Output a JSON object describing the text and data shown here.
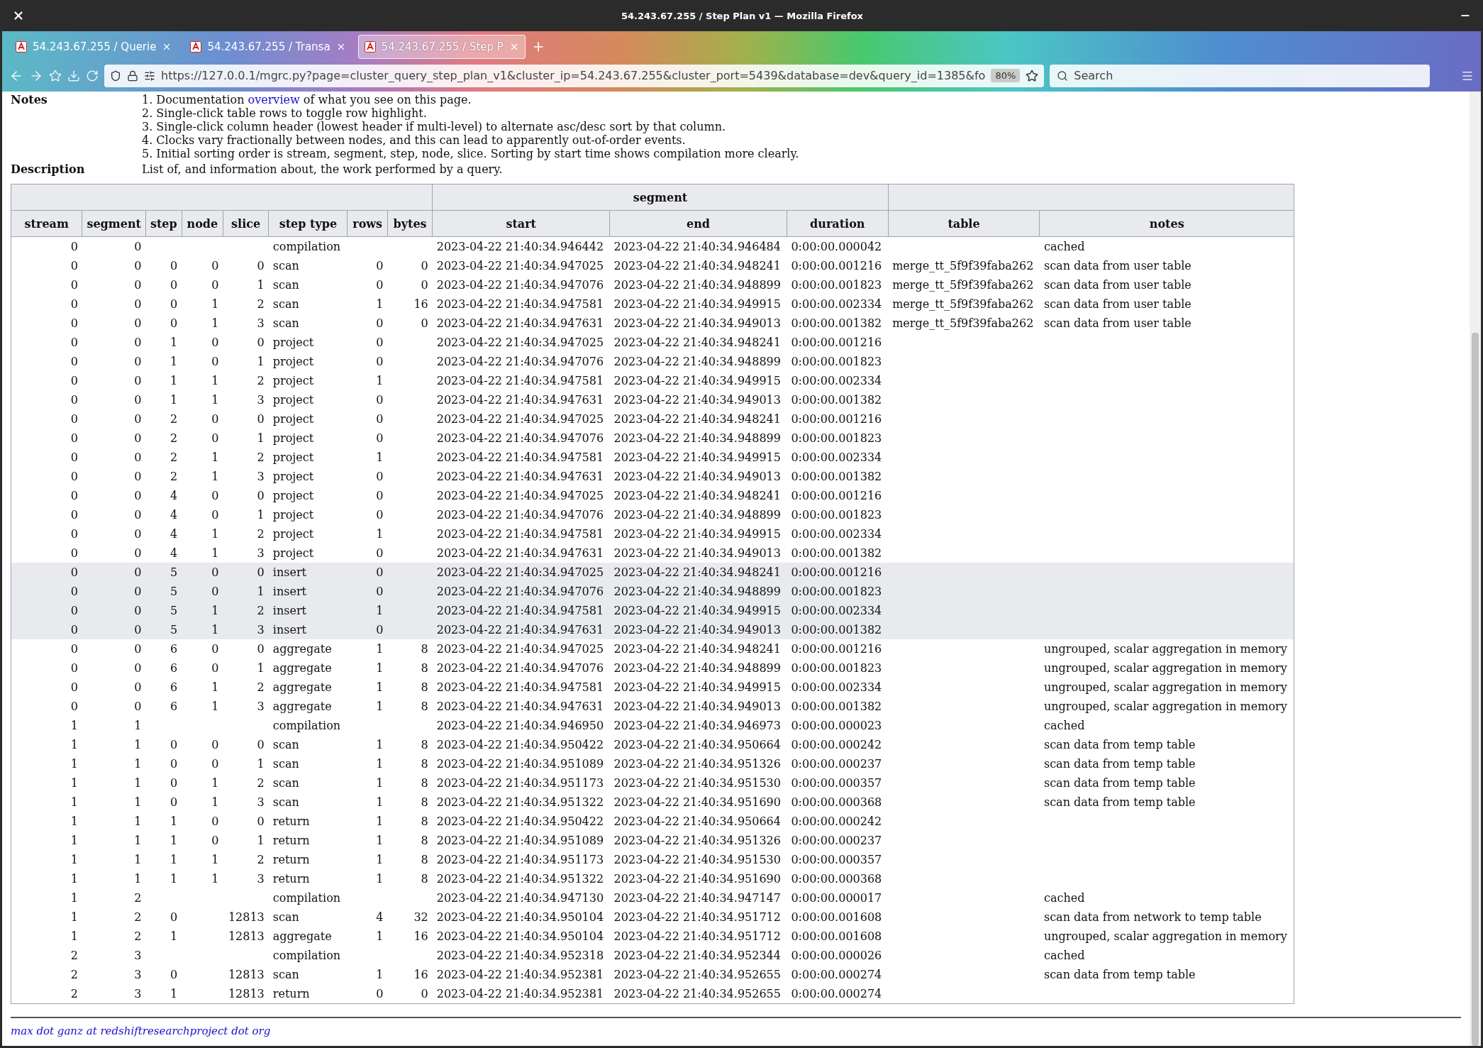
{
  "window": {
    "title": "54.243.67.255 / Step Plan v1 — Mozilla Firefox"
  },
  "tabs": [
    {
      "label": "54.243.67.255 / Querie",
      "selected": false
    },
    {
      "label": "54.243.67.255 / Transa",
      "selected": false
    },
    {
      "label": "54.243.67.255 / Step P",
      "selected": true
    }
  ],
  "address_bar": {
    "url": "https://127.0.0.1/mgrc.py?page=cluster_query_step_plan_v1&cluster_ip=54.243.67.255&cluster_port=5439&database=dev&query_id=1385&fo",
    "zoom": "80%"
  },
  "search": {
    "placeholder": "Search"
  },
  "notes": {
    "label": "Notes",
    "first": {
      "before": "1. Documentation ",
      "link": "overview",
      "after": " of what you see on this page."
    },
    "items": [
      "2. Single-click table rows to toggle row highlight.",
      "3. Single-click column header (lowest header if multi-level) to alternate asc/desc sort by that column.",
      "4. Clocks vary fractionally between nodes, and this can lead to apparently out-of-order events.",
      "5. Initial sorting order is stream, segment, step, node, slice. Sorting by start time shows compilation more clearly."
    ]
  },
  "description": {
    "label": "Description",
    "text": "List of, and information about, the work performed by a query."
  },
  "table": {
    "group_header": "segment",
    "columns": [
      "stream",
      "segment",
      "step",
      "node",
      "slice",
      "step type",
      "rows",
      "bytes",
      "start",
      "end",
      "duration",
      "table",
      "notes"
    ],
    "rows": [
      {
        "highlighted": false,
        "cells": [
          "0",
          "0",
          null,
          null,
          null,
          "compilation",
          null,
          null,
          "2023-04-22 21:40:34.946442",
          "2023-04-22 21:40:34.946484",
          "0:00:00.000042",
          null,
          "cached"
        ]
      },
      {
        "highlighted": false,
        "cells": [
          "0",
          "0",
          "0",
          "0",
          "0",
          "scan",
          "0",
          "0",
          "2023-04-22 21:40:34.947025",
          "2023-04-22 21:40:34.948241",
          "0:00:00.001216",
          "merge_tt_5f9f39faba262",
          "scan data from user table"
        ]
      },
      {
        "highlighted": false,
        "cells": [
          "0",
          "0",
          "0",
          "0",
          "1",
          "scan",
          "0",
          "0",
          "2023-04-22 21:40:34.947076",
          "2023-04-22 21:40:34.948899",
          "0:00:00.001823",
          "merge_tt_5f9f39faba262",
          "scan data from user table"
        ]
      },
      {
        "highlighted": false,
        "cells": [
          "0",
          "0",
          "0",
          "1",
          "2",
          "scan",
          "1",
          "16",
          "2023-04-22 21:40:34.947581",
          "2023-04-22 21:40:34.949915",
          "0:00:00.002334",
          "merge_tt_5f9f39faba262",
          "scan data from user table"
        ]
      },
      {
        "highlighted": false,
        "cells": [
          "0",
          "0",
          "0",
          "1",
          "3",
          "scan",
          "0",
          "0",
          "2023-04-22 21:40:34.947631",
          "2023-04-22 21:40:34.949013",
          "0:00:00.001382",
          "merge_tt_5f9f39faba262",
          "scan data from user table"
        ]
      },
      {
        "highlighted": false,
        "cells": [
          "0",
          "0",
          "1",
          "0",
          "0",
          "project",
          "0",
          null,
          "2023-04-22 21:40:34.947025",
          "2023-04-22 21:40:34.948241",
          "0:00:00.001216",
          null,
          null
        ]
      },
      {
        "highlighted": false,
        "cells": [
          "0",
          "0",
          "1",
          "0",
          "1",
          "project",
          "0",
          null,
          "2023-04-22 21:40:34.947076",
          "2023-04-22 21:40:34.948899",
          "0:00:00.001823",
          null,
          null
        ]
      },
      {
        "highlighted": false,
        "cells": [
          "0",
          "0",
          "1",
          "1",
          "2",
          "project",
          "1",
          null,
          "2023-04-22 21:40:34.947581",
          "2023-04-22 21:40:34.949915",
          "0:00:00.002334",
          null,
          null
        ]
      },
      {
        "highlighted": false,
        "cells": [
          "0",
          "0",
          "1",
          "1",
          "3",
          "project",
          "0",
          null,
          "2023-04-22 21:40:34.947631",
          "2023-04-22 21:40:34.949013",
          "0:00:00.001382",
          null,
          null
        ]
      },
      {
        "highlighted": false,
        "cells": [
          "0",
          "0",
          "2",
          "0",
          "0",
          "project",
          "0",
          null,
          "2023-04-22 21:40:34.947025",
          "2023-04-22 21:40:34.948241",
          "0:00:00.001216",
          null,
          null
        ]
      },
      {
        "highlighted": false,
        "cells": [
          "0",
          "0",
          "2",
          "0",
          "1",
          "project",
          "0",
          null,
          "2023-04-22 21:40:34.947076",
          "2023-04-22 21:40:34.948899",
          "0:00:00.001823",
          null,
          null
        ]
      },
      {
        "highlighted": false,
        "cells": [
          "0",
          "0",
          "2",
          "1",
          "2",
          "project",
          "1",
          null,
          "2023-04-22 21:40:34.947581",
          "2023-04-22 21:40:34.949915",
          "0:00:00.002334",
          null,
          null
        ]
      },
      {
        "highlighted": false,
        "cells": [
          "0",
          "0",
          "2",
          "1",
          "3",
          "project",
          "0",
          null,
          "2023-04-22 21:40:34.947631",
          "2023-04-22 21:40:34.949013",
          "0:00:00.001382",
          null,
          null
        ]
      },
      {
        "highlighted": false,
        "cells": [
          "0",
          "0",
          "4",
          "0",
          "0",
          "project",
          "0",
          null,
          "2023-04-22 21:40:34.947025",
          "2023-04-22 21:40:34.948241",
          "0:00:00.001216",
          null,
          null
        ]
      },
      {
        "highlighted": false,
        "cells": [
          "0",
          "0",
          "4",
          "0",
          "1",
          "project",
          "0",
          null,
          "2023-04-22 21:40:34.947076",
          "2023-04-22 21:40:34.948899",
          "0:00:00.001823",
          null,
          null
        ]
      },
      {
        "highlighted": false,
        "cells": [
          "0",
          "0",
          "4",
          "1",
          "2",
          "project",
          "1",
          null,
          "2023-04-22 21:40:34.947581",
          "2023-04-22 21:40:34.949915",
          "0:00:00.002334",
          null,
          null
        ]
      },
      {
        "highlighted": false,
        "cells": [
          "0",
          "0",
          "4",
          "1",
          "3",
          "project",
          "0",
          null,
          "2023-04-22 21:40:34.947631",
          "2023-04-22 21:40:34.949013",
          "0:00:00.001382",
          null,
          null
        ]
      },
      {
        "highlighted": true,
        "cells": [
          "0",
          "0",
          "5",
          "0",
          "0",
          "insert",
          "0",
          null,
          "2023-04-22 21:40:34.947025",
          "2023-04-22 21:40:34.948241",
          "0:00:00.001216",
          null,
          null
        ]
      },
      {
        "highlighted": true,
        "cells": [
          "0",
          "0",
          "5",
          "0",
          "1",
          "insert",
          "0",
          null,
          "2023-04-22 21:40:34.947076",
          "2023-04-22 21:40:34.948899",
          "0:00:00.001823",
          null,
          null
        ]
      },
      {
        "highlighted": true,
        "cells": [
          "0",
          "0",
          "5",
          "1",
          "2",
          "insert",
          "1",
          null,
          "2023-04-22 21:40:34.947581",
          "2023-04-22 21:40:34.949915",
          "0:00:00.002334",
          null,
          null
        ]
      },
      {
        "highlighted": true,
        "cells": [
          "0",
          "0",
          "5",
          "1",
          "3",
          "insert",
          "0",
          null,
          "2023-04-22 21:40:34.947631",
          "2023-04-22 21:40:34.949013",
          "0:00:00.001382",
          null,
          null
        ]
      },
      {
        "highlighted": false,
        "cells": [
          "0",
          "0",
          "6",
          "0",
          "0",
          "aggregate",
          "1",
          "8",
          "2023-04-22 21:40:34.947025",
          "2023-04-22 21:40:34.948241",
          "0:00:00.001216",
          null,
          "ungrouped, scalar aggregation in memory"
        ]
      },
      {
        "highlighted": false,
        "cells": [
          "0",
          "0",
          "6",
          "0",
          "1",
          "aggregate",
          "1",
          "8",
          "2023-04-22 21:40:34.947076",
          "2023-04-22 21:40:34.948899",
          "0:00:00.001823",
          null,
          "ungrouped, scalar aggregation in memory"
        ]
      },
      {
        "highlighted": false,
        "cells": [
          "0",
          "0",
          "6",
          "1",
          "2",
          "aggregate",
          "1",
          "8",
          "2023-04-22 21:40:34.947581",
          "2023-04-22 21:40:34.949915",
          "0:00:00.002334",
          null,
          "ungrouped, scalar aggregation in memory"
        ]
      },
      {
        "highlighted": false,
        "cells": [
          "0",
          "0",
          "6",
          "1",
          "3",
          "aggregate",
          "1",
          "8",
          "2023-04-22 21:40:34.947631",
          "2023-04-22 21:40:34.949013",
          "0:00:00.001382",
          null,
          "ungrouped, scalar aggregation in memory"
        ]
      },
      {
        "highlighted": false,
        "cells": [
          "1",
          "1",
          null,
          null,
          null,
          "compilation",
          null,
          null,
          "2023-04-22 21:40:34.946950",
          "2023-04-22 21:40:34.946973",
          "0:00:00.000023",
          null,
          "cached"
        ]
      },
      {
        "highlighted": false,
        "cells": [
          "1",
          "1",
          "0",
          "0",
          "0",
          "scan",
          "1",
          "8",
          "2023-04-22 21:40:34.950422",
          "2023-04-22 21:40:34.950664",
          "0:00:00.000242",
          null,
          "scan data from temp table"
        ]
      },
      {
        "highlighted": false,
        "cells": [
          "1",
          "1",
          "0",
          "0",
          "1",
          "scan",
          "1",
          "8",
          "2023-04-22 21:40:34.951089",
          "2023-04-22 21:40:34.951326",
          "0:00:00.000237",
          null,
          "scan data from temp table"
        ]
      },
      {
        "highlighted": false,
        "cells": [
          "1",
          "1",
          "0",
          "1",
          "2",
          "scan",
          "1",
          "8",
          "2023-04-22 21:40:34.951173",
          "2023-04-22 21:40:34.951530",
          "0:00:00.000357",
          null,
          "scan data from temp table"
        ]
      },
      {
        "highlighted": false,
        "cells": [
          "1",
          "1",
          "0",
          "1",
          "3",
          "scan",
          "1",
          "8",
          "2023-04-22 21:40:34.951322",
          "2023-04-22 21:40:34.951690",
          "0:00:00.000368",
          null,
          "scan data from temp table"
        ]
      },
      {
        "highlighted": false,
        "cells": [
          "1",
          "1",
          "1",
          "0",
          "0",
          "return",
          "1",
          "8",
          "2023-04-22 21:40:34.950422",
          "2023-04-22 21:40:34.950664",
          "0:00:00.000242",
          null,
          null
        ]
      },
      {
        "highlighted": false,
        "cells": [
          "1",
          "1",
          "1",
          "0",
          "1",
          "return",
          "1",
          "8",
          "2023-04-22 21:40:34.951089",
          "2023-04-22 21:40:34.951326",
          "0:00:00.000237",
          null,
          null
        ]
      },
      {
        "highlighted": false,
        "cells": [
          "1",
          "1",
          "1",
          "1",
          "2",
          "return",
          "1",
          "8",
          "2023-04-22 21:40:34.951173",
          "2023-04-22 21:40:34.951530",
          "0:00:00.000357",
          null,
          null
        ]
      },
      {
        "highlighted": false,
        "cells": [
          "1",
          "1",
          "1",
          "1",
          "3",
          "return",
          "1",
          "8",
          "2023-04-22 21:40:34.951322",
          "2023-04-22 21:40:34.951690",
          "0:00:00.000368",
          null,
          null
        ]
      },
      {
        "highlighted": false,
        "cells": [
          "1",
          "2",
          null,
          null,
          null,
          "compilation",
          null,
          null,
          "2023-04-22 21:40:34.947130",
          "2023-04-22 21:40:34.947147",
          "0:00:00.000017",
          null,
          "cached"
        ]
      },
      {
        "highlighted": false,
        "cells": [
          "1",
          "2",
          "0",
          null,
          "12813",
          "scan",
          "4",
          "32",
          "2023-04-22 21:40:34.950104",
          "2023-04-22 21:40:34.951712",
          "0:00:00.001608",
          null,
          "scan data from network to temp table"
        ]
      },
      {
        "highlighted": false,
        "cells": [
          "1",
          "2",
          "1",
          null,
          "12813",
          "aggregate",
          "1",
          "16",
          "2023-04-22 21:40:34.950104",
          "2023-04-22 21:40:34.951712",
          "0:00:00.001608",
          null,
          "ungrouped, scalar aggregation in memory"
        ]
      },
      {
        "highlighted": false,
        "cells": [
          "2",
          "3",
          null,
          null,
          null,
          "compilation",
          null,
          null,
          "2023-04-22 21:40:34.952318",
          "2023-04-22 21:40:34.952344",
          "0:00:00.000026",
          null,
          "cached"
        ]
      },
      {
        "highlighted": false,
        "cells": [
          "2",
          "3",
          "0",
          null,
          "12813",
          "scan",
          "1",
          "16",
          "2023-04-22 21:40:34.952381",
          "2023-04-22 21:40:34.952655",
          "0:00:00.000274",
          null,
          "scan data from temp table"
        ]
      },
      {
        "highlighted": false,
        "cells": [
          "2",
          "3",
          "1",
          null,
          "12813",
          "return",
          "0",
          "0",
          "2023-04-22 21:40:34.952381",
          "2023-04-22 21:40:34.952655",
          "0:00:00.000274",
          null,
          null
        ]
      }
    ]
  },
  "footer": {
    "contact": "max dot ganz at redshiftresearchproject dot org"
  }
}
